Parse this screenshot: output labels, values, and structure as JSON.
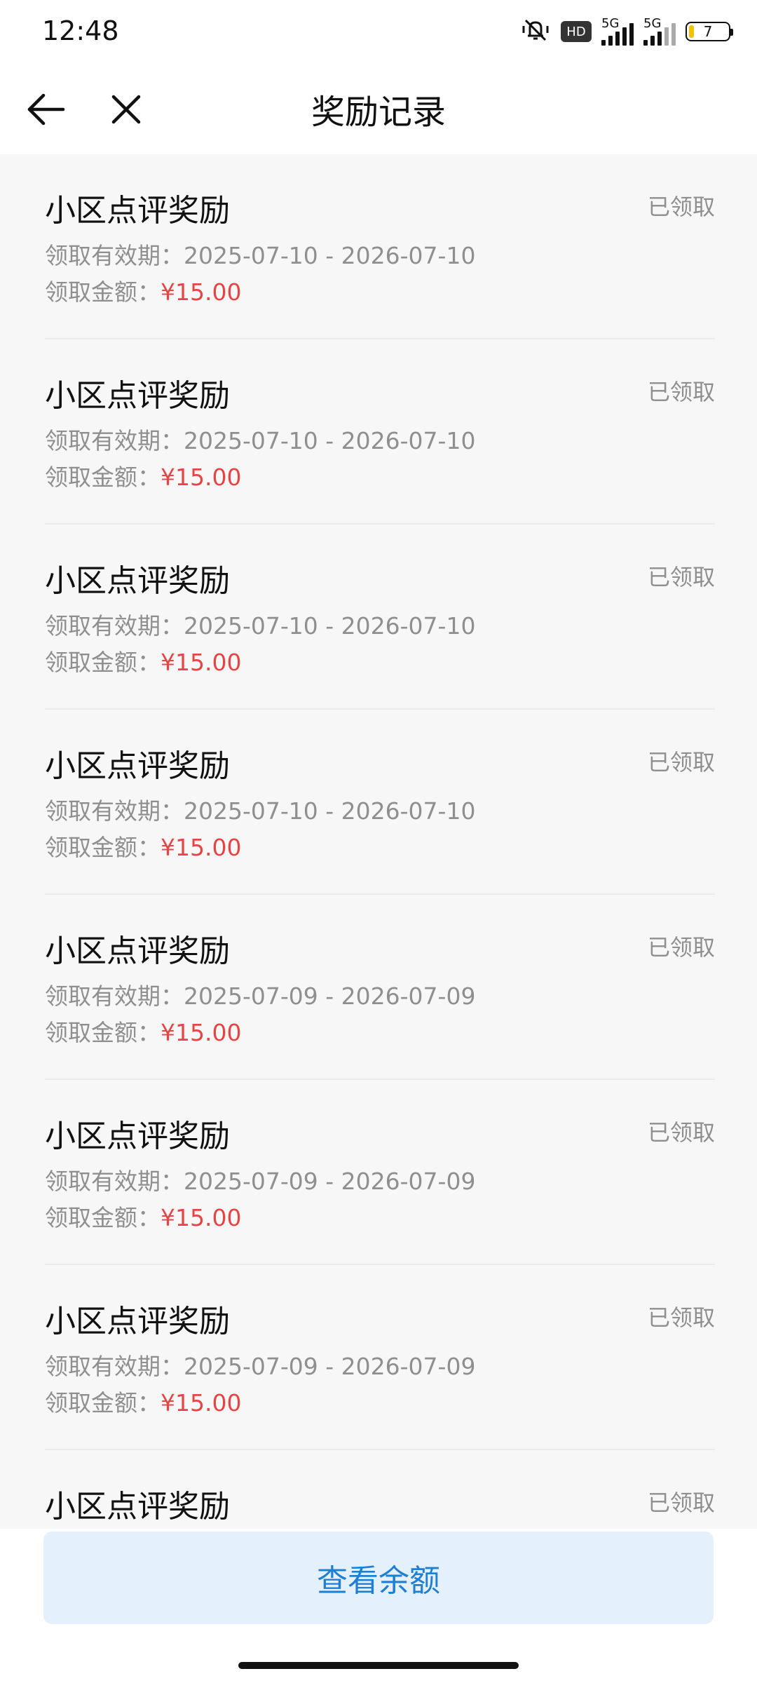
{
  "status_bar": {
    "time": "12:48",
    "hd_label": "HD",
    "network_1": "5G",
    "network_2": "5G",
    "battery": "7"
  },
  "header": {
    "title": "奖励记录"
  },
  "records": [
    {
      "title": "小区点评奖励",
      "status": "已领取",
      "period_label": "领取有效期：",
      "period": "2025-07-10 - 2026-07-10",
      "amount_label": "领取金额：",
      "amount": "¥15.00"
    },
    {
      "title": "小区点评奖励",
      "status": "已领取",
      "period_label": "领取有效期：",
      "period": "2025-07-10 - 2026-07-10",
      "amount_label": "领取金额：",
      "amount": "¥15.00"
    },
    {
      "title": "小区点评奖励",
      "status": "已领取",
      "period_label": "领取有效期：",
      "period": "2025-07-10 - 2026-07-10",
      "amount_label": "领取金额：",
      "amount": "¥15.00"
    },
    {
      "title": "小区点评奖励",
      "status": "已领取",
      "period_label": "领取有效期：",
      "period": "2025-07-10 - 2026-07-10",
      "amount_label": "领取金额：",
      "amount": "¥15.00"
    },
    {
      "title": "小区点评奖励",
      "status": "已领取",
      "period_label": "领取有效期：",
      "period": "2025-07-09 - 2026-07-09",
      "amount_label": "领取金额：",
      "amount": "¥15.00"
    },
    {
      "title": "小区点评奖励",
      "status": "已领取",
      "period_label": "领取有效期：",
      "period": "2025-07-09 - 2026-07-09",
      "amount_label": "领取金额：",
      "amount": "¥15.00"
    },
    {
      "title": "小区点评奖励",
      "status": "已领取",
      "period_label": "领取有效期：",
      "period": "2025-07-09 - 2026-07-09",
      "amount_label": "领取金额：",
      "amount": "¥15.00"
    },
    {
      "title": "小区点评奖励",
      "status": "已领取"
    }
  ],
  "footer": {
    "balance_button": "查看余额"
  },
  "colors": {
    "amount": "#e64545",
    "accent": "#1f7fd1",
    "button_bg": "#e4f0fb"
  }
}
